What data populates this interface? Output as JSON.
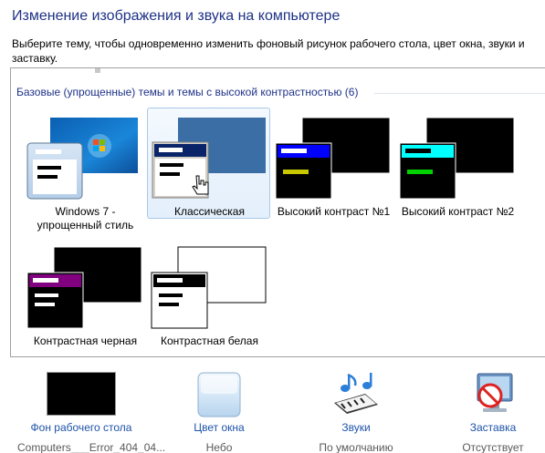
{
  "header": {
    "title": "Изменение изображения и звука на компьютере",
    "description": "Выберите тему, чтобы одновременно изменить фоновый рисунок рабочего стола, цвет окна, звуки и заставку."
  },
  "themes_group": {
    "header": "Базовые (упрощенные) темы и темы с высокой контрастностью (6)",
    "items": [
      {
        "label": "Windows 7 - упрощенный стиль"
      },
      {
        "label": "Классическая"
      },
      {
        "label": "Высокий контраст №1"
      },
      {
        "label": "Высокий контраст №2"
      },
      {
        "label": "Контрастная черная"
      },
      {
        "label": "Контрастная белая"
      }
    ],
    "selected_index": 1
  },
  "bottom_items": [
    {
      "link": "Фон рабочего стола",
      "value": "Computers___Error_404_04...",
      "icon": "desktop-background-icon"
    },
    {
      "link": "Цвет окна",
      "value": "Небо",
      "icon": "window-color-icon"
    },
    {
      "link": "Звуки",
      "value": "По умолчанию",
      "icon": "sounds-icon"
    },
    {
      "link": "Заставка",
      "value": "Отсутствует",
      "icon": "screensaver-icon"
    }
  ],
  "colors": {
    "title": "#1e3287",
    "link": "#1e53a8",
    "selected_tile": "#e3effb",
    "classic_blue": "#3a6ea5",
    "hc1_accent": "#0000ff",
    "hc2_accent": "#00ffff",
    "hc_black_accent": "#800080"
  }
}
